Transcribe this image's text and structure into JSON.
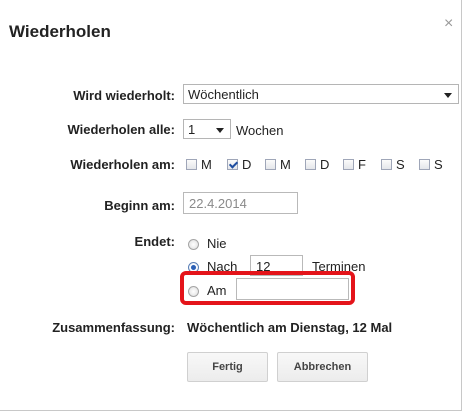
{
  "dialog": {
    "title": "Wiederholen",
    "close_glyph": "×"
  },
  "form": {
    "repeat_label": "Wird wiederholt:",
    "repeat_value": "Wöchentlich",
    "interval_label": "Wiederholen alle:",
    "interval_value": "1",
    "interval_unit": "Wochen",
    "days_label": "Wiederholen am:",
    "days": [
      {
        "label": "M",
        "checked": false
      },
      {
        "label": "D",
        "checked": true
      },
      {
        "label": "M",
        "checked": false
      },
      {
        "label": "D",
        "checked": false
      },
      {
        "label": "F",
        "checked": false
      },
      {
        "label": "S",
        "checked": false
      },
      {
        "label": "S",
        "checked": false
      }
    ],
    "start_label": "Beginn am:",
    "start_value": "22.4.2014",
    "end_label": "Endet:",
    "end_options": {
      "never_label": "Nie",
      "after_label": "Nach",
      "after_count": "12",
      "after_unit": "Terminen",
      "on_label": "Am",
      "on_value": ""
    },
    "selected_end": "after",
    "summary_label": "Zusammenfassung:",
    "summary_value": "Wöchentlich am Dienstag, 12 Mal"
  },
  "buttons": {
    "done": "Fertig",
    "cancel": "Abbrechen"
  },
  "colors": {
    "highlight": "#e4141a",
    "checked_accent": "#2a5fb5"
  }
}
